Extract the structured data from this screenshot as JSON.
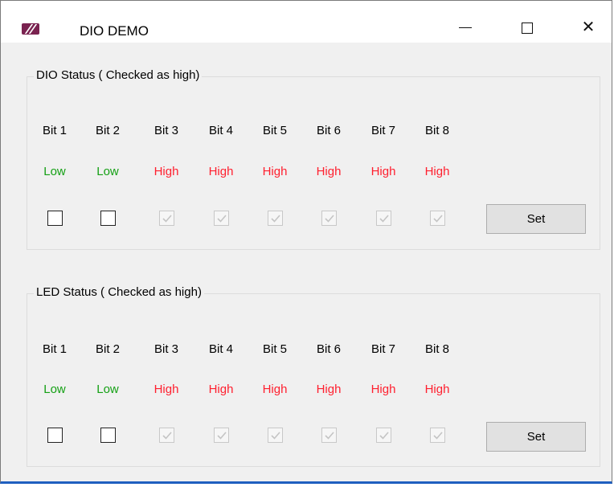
{
  "window": {
    "title": "DIO DEMO",
    "minimize_glyph": "—",
    "maximize_glyph": "☐",
    "close_glyph": "✕"
  },
  "colors": {
    "low": "#14a014",
    "high": "#ff1f2e"
  },
  "dio": {
    "title": "DIO Status ( Checked as high)",
    "bits": [
      {
        "label": "Bit 1",
        "state": "Low",
        "checked": false,
        "enabled": true
      },
      {
        "label": "Bit 2",
        "state": "Low",
        "checked": false,
        "enabled": true
      },
      {
        "label": "Bit 3",
        "state": "High",
        "checked": true,
        "enabled": false
      },
      {
        "label": "Bit 4",
        "state": "High",
        "checked": true,
        "enabled": false
      },
      {
        "label": "Bit 5",
        "state": "High",
        "checked": true,
        "enabled": false
      },
      {
        "label": "Bit 6",
        "state": "High",
        "checked": true,
        "enabled": false
      },
      {
        "label": "Bit 7",
        "state": "High",
        "checked": true,
        "enabled": false
      },
      {
        "label": "Bit 8",
        "state": "High",
        "checked": true,
        "enabled": false
      }
    ],
    "set_label": "Set"
  },
  "led": {
    "title": "LED Status ( Checked as high)",
    "bits": [
      {
        "label": "Bit 1",
        "state": "Low",
        "checked": false,
        "enabled": true
      },
      {
        "label": "Bit 2",
        "state": "Low",
        "checked": false,
        "enabled": true
      },
      {
        "label": "Bit 3",
        "state": "High",
        "checked": true,
        "enabled": false
      },
      {
        "label": "Bit 4",
        "state": "High",
        "checked": true,
        "enabled": false
      },
      {
        "label": "Bit 5",
        "state": "High",
        "checked": true,
        "enabled": false
      },
      {
        "label": "Bit 6",
        "state": "High",
        "checked": true,
        "enabled": false
      },
      {
        "label": "Bit 7",
        "state": "High",
        "checked": true,
        "enabled": false
      },
      {
        "label": "Bit 8",
        "state": "High",
        "checked": true,
        "enabled": false
      }
    ],
    "set_label": "Set"
  }
}
